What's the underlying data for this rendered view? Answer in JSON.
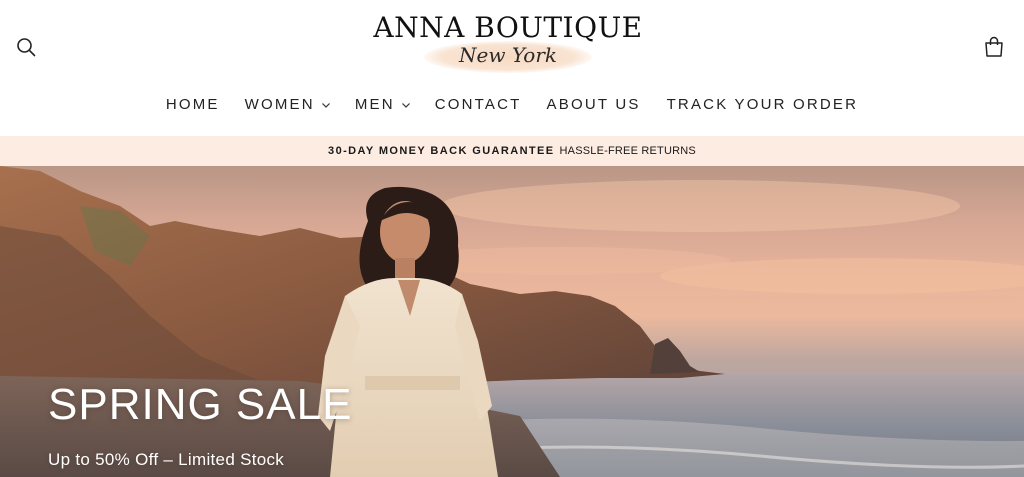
{
  "header": {
    "logo": {
      "title": "ANNA BOUTIQUE",
      "subtitle": "New York"
    },
    "icons": {
      "search": "search-icon",
      "cart": "shopping-bag-icon"
    }
  },
  "nav": {
    "items": [
      {
        "label": "HOME",
        "has_dropdown": false
      },
      {
        "label": "WOMEN",
        "has_dropdown": true
      },
      {
        "label": "MEN",
        "has_dropdown": true
      },
      {
        "label": "CONTACT",
        "has_dropdown": false
      },
      {
        "label": "ABOUT US",
        "has_dropdown": false
      },
      {
        "label": "TRACK YOUR ORDER",
        "has_dropdown": false
      }
    ]
  },
  "announcement": {
    "bold": "30-DAY MONEY BACK GUARANTEE",
    "text": "HASSLE-FREE RETURNS",
    "background": "#fdece2"
  },
  "hero": {
    "title": "SPRING SALE",
    "subtitle": "Up to 50% Off – Limited Stock"
  },
  "colors": {
    "text": "#1f1f1f",
    "logo_brush": "#f7dac3",
    "hero_text": "#ffffff"
  }
}
